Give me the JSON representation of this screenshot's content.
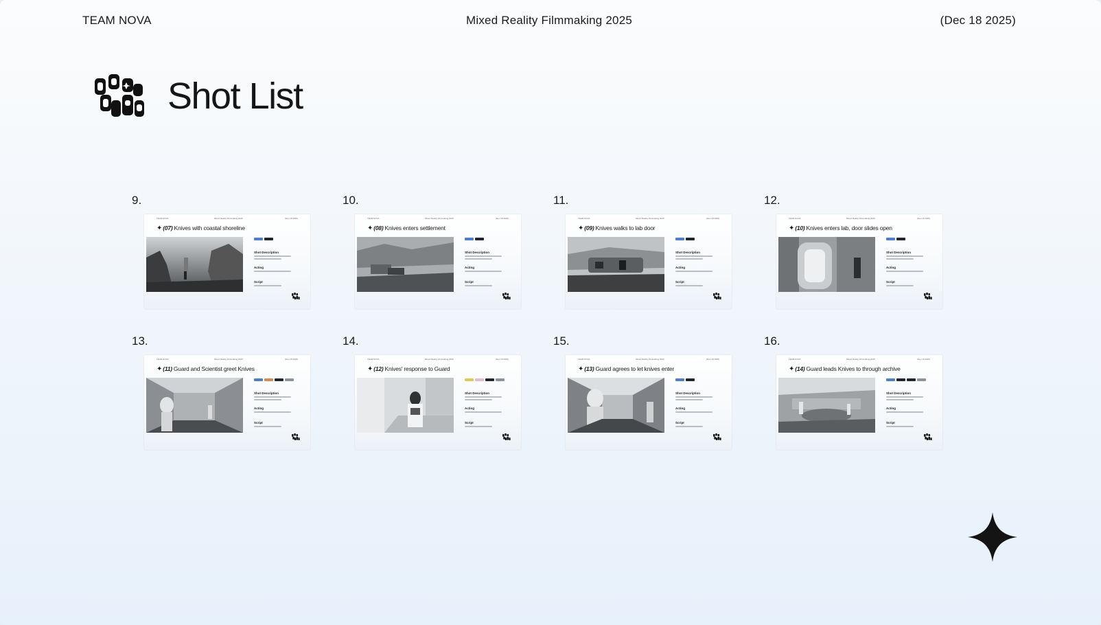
{
  "header": {
    "team": "TEAM NOVA",
    "project": "Mixed Reality Filmmaking 2025",
    "date": "(Dec 18 2025)"
  },
  "page": {
    "title": "Shot List"
  },
  "icons": {
    "logo": "team-logo-icon",
    "sparkle": "four-point-star-icon"
  },
  "colors": {
    "text": "#161616",
    "tag_blue": "#4d7cd6",
    "tag_orange": "#d9894a",
    "tag_yellow": "#e8c64a",
    "tag_pink": "#e9b9c9",
    "tag_dark": "#1e2430",
    "tag_gray": "#8d939c"
  },
  "section_labels": {
    "description": "Shot Description",
    "acting": "Acting",
    "script": "Script"
  },
  "shots": [
    {
      "number": "9.",
      "code": "(07)",
      "title": "Knives with coastal shoreline"
    },
    {
      "number": "10.",
      "code": "(08)",
      "title": "Knives enters settlement"
    },
    {
      "number": "11.",
      "code": "(09)",
      "title": "Knives walks to lab door"
    },
    {
      "number": "12.",
      "code": "(10)",
      "title": "Knives enters lab, door slides open"
    },
    {
      "number": "13.",
      "code": "(11)",
      "title": "Guard and Scientist greet Knives"
    },
    {
      "number": "14.",
      "code": "(12)",
      "title": "Knives' response to Guard"
    },
    {
      "number": "15.",
      "code": "(13)",
      "title": "Guard agrees to let knives enter"
    },
    {
      "number": "16.",
      "code": "(14)",
      "title": "Guard leads Knives to through archive"
    }
  ]
}
